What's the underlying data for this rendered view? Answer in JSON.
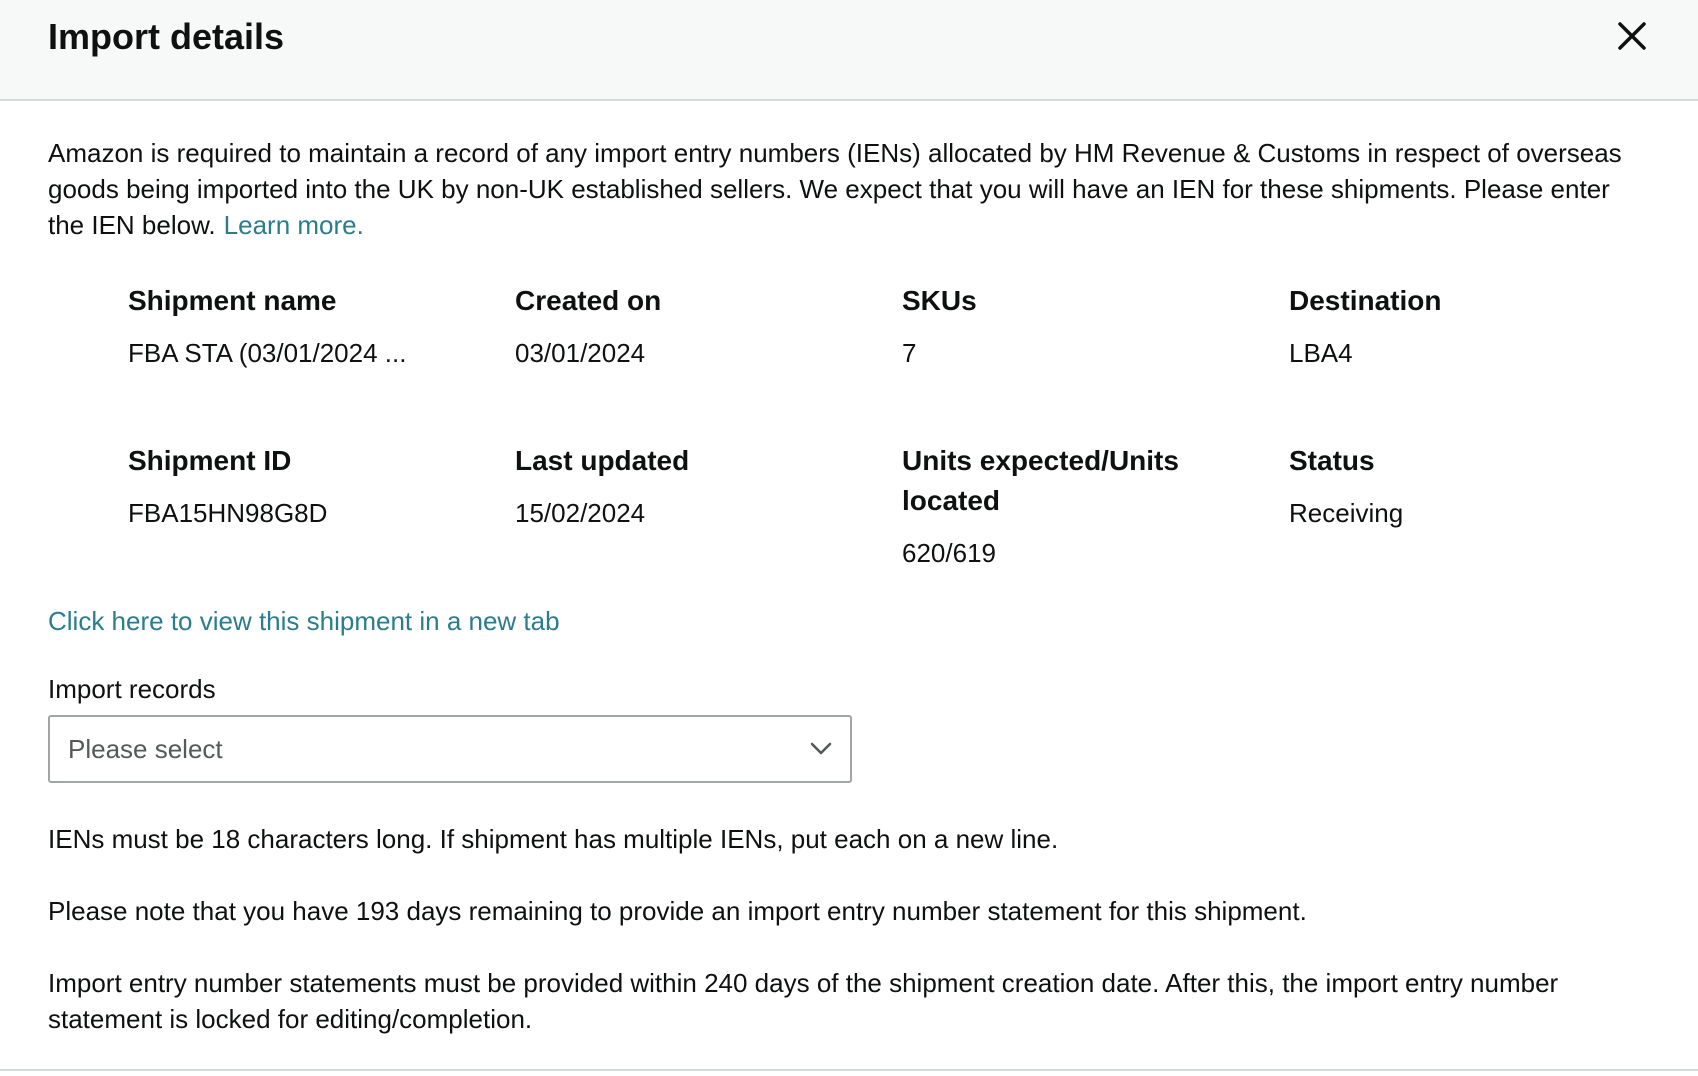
{
  "modal": {
    "title": "Import details",
    "close_icon": "close-icon"
  },
  "intro": {
    "text": "Amazon is required to maintain a record of any import entry numbers (IENs) allocated by HM Revenue & Customs in respect of overseas goods being imported into the UK by non-UK established sellers. We expect that you will have an IEN for these shipments. Please enter the IEN below.",
    "learn_more": "Learn more."
  },
  "shipment": {
    "name_label": "Shipment name",
    "name_value": "FBA STA (03/01/2024 ...",
    "created_label": "Created on",
    "created_value": "03/01/2024",
    "skus_label": "SKUs",
    "skus_value": "7",
    "destination_label": "Destination",
    "destination_value": "LBA4",
    "id_label": "Shipment ID",
    "id_value": "FBA15HN98G8D",
    "updated_label": "Last updated",
    "updated_value": "15/02/2024",
    "units_label": "Units expected/Units located",
    "units_value": "620/619",
    "status_label": "Status",
    "status_value": "Receiving"
  },
  "view_link": "Click here to view this shipment in a new tab",
  "import_records": {
    "label": "Import records",
    "placeholder": "Please select",
    "icon": "chevron-down-icon"
  },
  "notes": {
    "length_rule": "IENs must be 18 characters long. If shipment has multiple IENs, put each on a new line.",
    "days_remaining": "Please note that you have 193 days remaining to provide an import entry number statement for this shipment.",
    "deadline": "Import entry number statements must be provided within 240 days of the shipment creation date. After this, the import entry number statement is locked for editing/completion."
  },
  "colors": {
    "link": "#2a7d8e",
    "text": "#0f1111",
    "header_bg": "#f7f8f8",
    "border": "#d5d9d9"
  }
}
